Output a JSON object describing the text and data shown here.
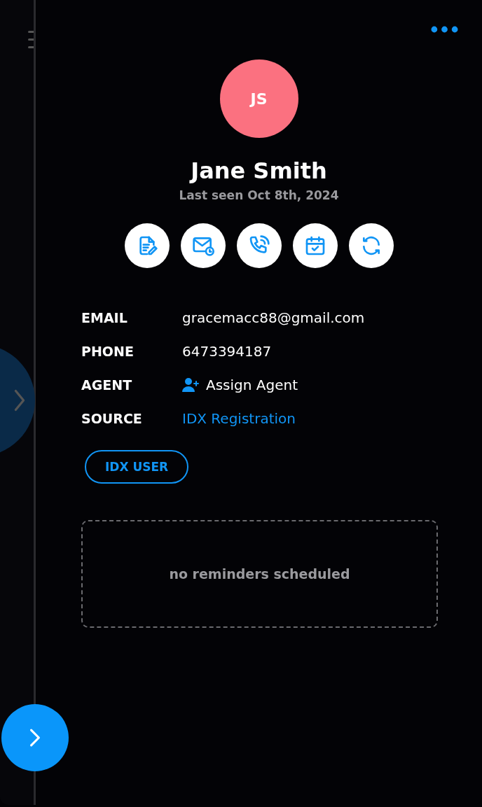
{
  "contact": {
    "initials": "JS",
    "name": "Jane Smith",
    "last_seen": "Last seen Oct 8th, 2024"
  },
  "actions": [
    {
      "kind": "note"
    },
    {
      "kind": "email"
    },
    {
      "kind": "call"
    },
    {
      "kind": "calendar"
    },
    {
      "kind": "sync"
    }
  ],
  "fields": [
    {
      "label": "EMAIL",
      "value": "gracemacc88@gmail.com",
      "kind": "text"
    },
    {
      "label": "PHONE",
      "value": "6473394187",
      "kind": "text"
    },
    {
      "label": "AGENT",
      "value": "Assign Agent",
      "kind": "assign"
    },
    {
      "label": "SOURCE",
      "value": "IDX Registration",
      "kind": "link"
    }
  ],
  "tags": [
    "IDX USER"
  ],
  "reminders": {
    "empty_text": "no reminders scheduled"
  }
}
